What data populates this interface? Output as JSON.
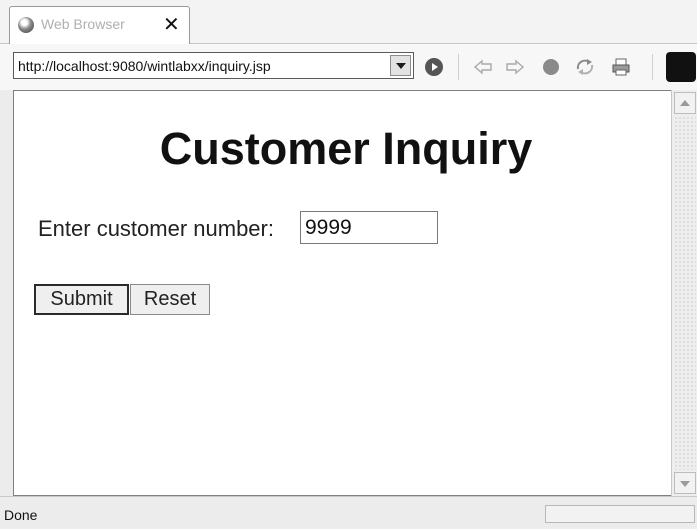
{
  "tab": {
    "title": "Web Browser",
    "close_glyph": "✕",
    "icon": "globe-icon"
  },
  "toolbar": {
    "url": "http://localhost:9080/wintlabxx/inquiry.jsp",
    "icons": [
      "go-icon",
      "back-icon",
      "forward-icon",
      "stop-icon",
      "refresh-icon",
      "print-icon"
    ]
  },
  "page": {
    "title": "Customer Inquiry",
    "field_label": "Enter customer number:",
    "field_value": "9999",
    "submit_label": "Submit",
    "reset_label": "Reset"
  },
  "status": {
    "text": "Done"
  }
}
